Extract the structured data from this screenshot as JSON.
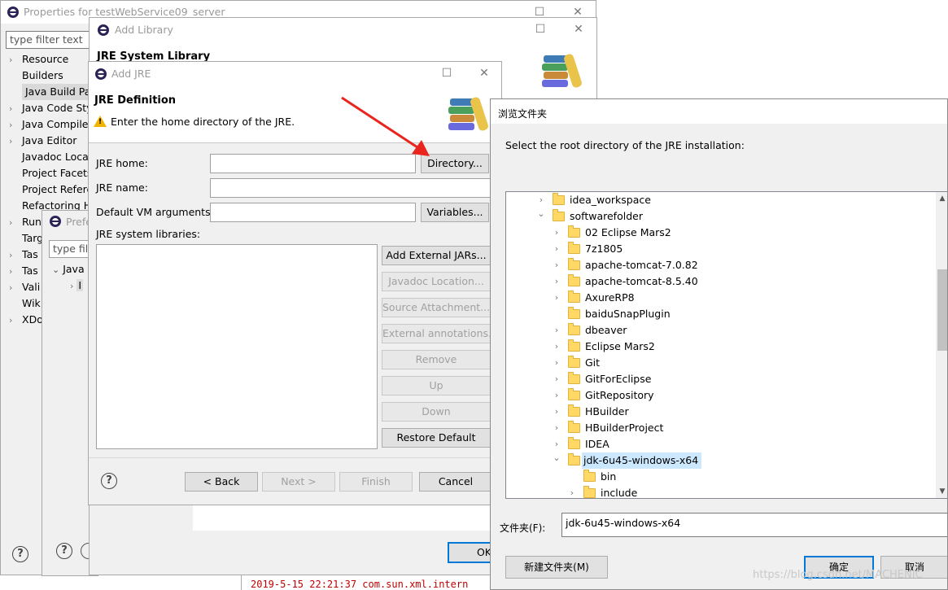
{
  "properties_window": {
    "title": "Properties for testWebService09_server",
    "filter_placeholder": "type filter text",
    "tree": [
      "Resource",
      "Builders",
      "Java Build Path",
      "Java Code Style",
      "Java Compiler",
      "Java Editor",
      "Javadoc Location",
      "Project Facets",
      "Project References",
      "Refactoring History",
      "Run/Debug Settings",
      "Target Runtimes",
      "Task Repository",
      "Task Tags",
      "Validation",
      "WikiText",
      "XDoclet"
    ],
    "tree_visible": [
      "Resource",
      "Builders",
      "Java Build Pat",
      "Java Code Sty",
      "Java Compile",
      "Java Editor",
      "Javadoc Loca",
      "Project Facets",
      "Project Refere",
      "Refactoring H",
      "Run",
      "Targ",
      "Tas",
      "Tas",
      "Vali",
      "Wik",
      "XDo"
    ]
  },
  "preferences_window": {
    "title": "Prefe",
    "filter_placeholder": "type filte",
    "tree_item": "Java",
    "tree_subitem": "I"
  },
  "add_library": {
    "title": "Add Library",
    "heading": "JRE System Library",
    "ok": "OK"
  },
  "add_jre": {
    "title": "Add JRE",
    "heading": "JRE Definition",
    "message": "Enter the home directory of the JRE.",
    "jre_home_label": "JRE home:",
    "jre_home_value": "",
    "jre_name_label": "JRE name:",
    "jre_name_value": "",
    "vm_args_label": "Default VM arguments:",
    "vm_args_value": "",
    "libraries_label": "JRE system libraries:",
    "buttons": {
      "directory": "Directory...",
      "variables": "Variables...",
      "add_external_jars": "Add External JARs...",
      "javadoc_location": "Javadoc Location...",
      "source_attachment": "Source Attachment...",
      "external_annotations": "External annotations...",
      "remove": "Remove",
      "up": "Up",
      "down": "Down",
      "restore_default": "Restore Default"
    },
    "footer": {
      "back": "< Back",
      "next": "Next >",
      "finish": "Finish",
      "cancel": "Cancel"
    }
  },
  "browse_folder": {
    "title": "浏览文件夹",
    "instruction": "Select the root directory of the JRE installation:",
    "tree": [
      {
        "label": "idea_workspace",
        "depth": 0,
        "chevron": "collapsed"
      },
      {
        "label": "softwarefolder",
        "depth": 0,
        "chevron": "expanded"
      },
      {
        "label": "02 Eclipse Mars2",
        "depth": 1,
        "chevron": "collapsed"
      },
      {
        "label": "7z1805",
        "depth": 1,
        "chevron": "collapsed"
      },
      {
        "label": "apache-tomcat-7.0.82",
        "depth": 1,
        "chevron": "collapsed"
      },
      {
        "label": "apache-tomcat-8.5.40",
        "depth": 1,
        "chevron": "collapsed"
      },
      {
        "label": "AxureRP8",
        "depth": 1,
        "chevron": "collapsed"
      },
      {
        "label": "baiduSnapPlugin",
        "depth": 1,
        "chevron": "none"
      },
      {
        "label": "dbeaver",
        "depth": 1,
        "chevron": "collapsed"
      },
      {
        "label": "Eclipse Mars2",
        "depth": 1,
        "chevron": "collapsed"
      },
      {
        "label": "Git",
        "depth": 1,
        "chevron": "collapsed"
      },
      {
        "label": "GitForEclipse",
        "depth": 1,
        "chevron": "collapsed"
      },
      {
        "label": "GitRepository",
        "depth": 1,
        "chevron": "collapsed"
      },
      {
        "label": "HBuilder",
        "depth": 1,
        "chevron": "collapsed"
      },
      {
        "label": "HBuilderProject",
        "depth": 1,
        "chevron": "collapsed"
      },
      {
        "label": "IDEA",
        "depth": 1,
        "chevron": "collapsed"
      },
      {
        "label": "jdk-6u45-windows-x64",
        "depth": 1,
        "chevron": "expanded",
        "selected": true
      },
      {
        "label": "bin",
        "depth": 2,
        "chevron": "none"
      },
      {
        "label": "include",
        "depth": 2,
        "chevron": "collapsed"
      }
    ],
    "folder_label": "文件夹(F):",
    "folder_value": "jdk-6u45-windows-x64",
    "new_folder": "新建文件夹(M)",
    "ok": "确定",
    "cancel": "取消"
  },
  "console_line": "2019-5-15 22:21:37 com.sun.xml.intern",
  "watermark": "https://blog.csdn.net/MACHENIC",
  "colors": {
    "selection": "#cce8ff",
    "arrow": "#e8261e",
    "console_red": "#c00000"
  }
}
